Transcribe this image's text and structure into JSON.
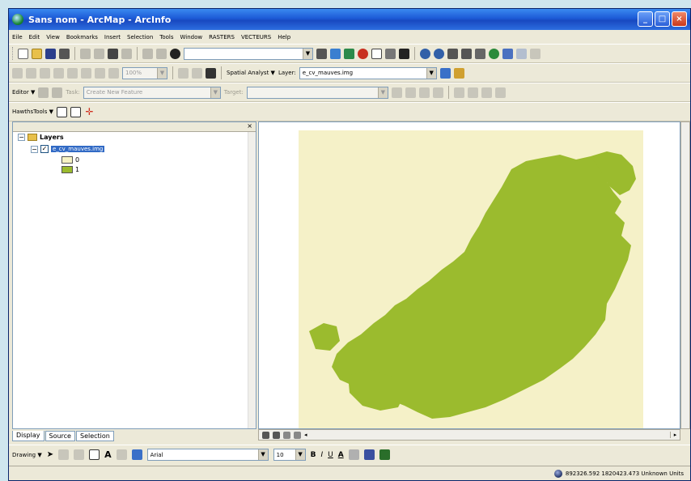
{
  "window": {
    "title": "Sans nom - ArcMap - ArcInfo",
    "controls": [
      "_",
      "□",
      "×"
    ]
  },
  "menubar": {
    "items": [
      "Eile",
      "Edit",
      "View",
      "Bookmarks",
      "Insert",
      "Selection",
      "Tools",
      "Window",
      "RASTERS",
      "VECTEURS",
      "Help"
    ]
  },
  "standard_toolbar": {
    "scale_value": "",
    "zoom_value": "100%"
  },
  "spatial_analyst_toolbar": {
    "label": "Spatial Analyst ▼",
    "layer_label": "Layer:",
    "layer_value": "e_cv_mauves.img"
  },
  "editor_toolbar": {
    "editor_label": "Editor ▼",
    "task_label": "Task:",
    "task_value": "Create New Feature",
    "target_label": "Target:",
    "target_value": ""
  },
  "hawths_toolbar": {
    "label": "HawthsTools ▼"
  },
  "toc": {
    "root_label": "Layers",
    "layer_name": "e_cv_mauves.img",
    "legend": [
      {
        "label": "0",
        "color": "#f6f2c4"
      },
      {
        "label": "1",
        "color": "#9bbb2e"
      }
    ],
    "tabs": [
      "Display",
      "Source",
      "Selection"
    ]
  },
  "map": {
    "background_color": "#f5f1c8",
    "forest_color": "#9bbb2e"
  },
  "drawing_toolbar": {
    "drawing_label": "Drawing ▼",
    "font_name": "Arial",
    "font_size": "10",
    "bold_label": "B",
    "italic_label": "I",
    "underline_label": "U"
  },
  "statusbar": {
    "coordinates": "892326.592  1820423.473 Unknown Units"
  },
  "colors": {
    "title_bar": "#1c5ad6",
    "chrome": "#ece9d8",
    "selection": "#316ac5"
  }
}
